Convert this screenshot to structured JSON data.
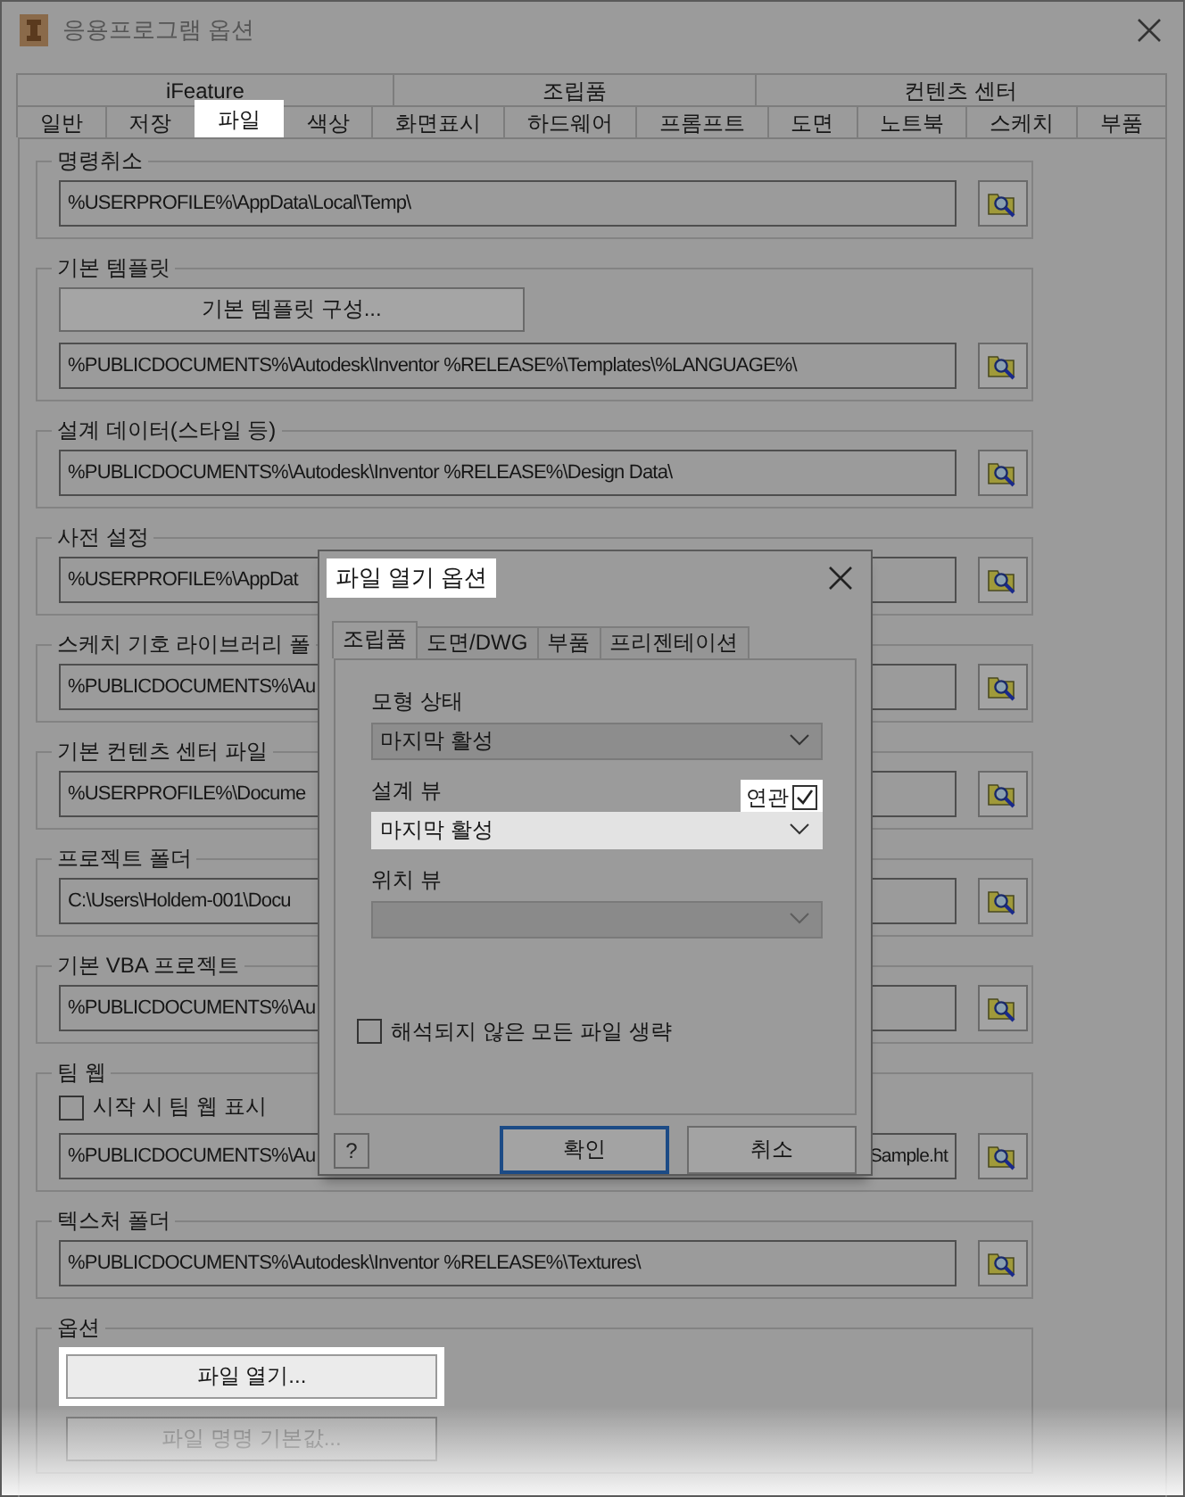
{
  "window": {
    "title": "응용프로그램 옵션"
  },
  "tab_rows": [
    [
      {
        "label": "iFeature",
        "selected": false
      },
      {
        "label": "조립품",
        "selected": false
      },
      {
        "label": "컨텐츠 센터",
        "selected": false
      }
    ],
    [
      {
        "label": "일반",
        "selected": false
      },
      {
        "label": "저장",
        "selected": false
      },
      {
        "label": "파일",
        "selected": true
      },
      {
        "label": "색상",
        "selected": false
      },
      {
        "label": "화면표시",
        "selected": false
      },
      {
        "label": "하드웨어",
        "selected": false
      },
      {
        "label": "프롬프트",
        "selected": false
      },
      {
        "label": "도면",
        "selected": false
      },
      {
        "label": "노트북",
        "selected": false
      },
      {
        "label": "스케치",
        "selected": false
      },
      {
        "label": "부품",
        "selected": false
      }
    ]
  ],
  "groups": [
    {
      "title": "명령취소",
      "items": [
        {
          "kind": "path",
          "value": "%USERPROFILE%\\AppData\\Local\\Temp\\"
        }
      ]
    },
    {
      "title": "기본 템플릿",
      "items": [
        {
          "kind": "button",
          "label": "기본 템플릿 구성...",
          "highlighted": false,
          "disabled": false
        },
        {
          "kind": "path",
          "value": "%PUBLICDOCUMENTS%\\Autodesk\\Inventor %RELEASE%\\Templates\\%LANGUAGE%\\"
        }
      ]
    },
    {
      "title": "설계 데이터(스타일 등)",
      "items": [
        {
          "kind": "path",
          "value": "%PUBLICDOCUMENTS%\\Autodesk\\Inventor %RELEASE%\\Design Data\\"
        }
      ]
    },
    {
      "title": "사전 설정",
      "items": [
        {
          "kind": "path",
          "value": "%USERPROFILE%\\AppDat"
        }
      ]
    },
    {
      "title": "스케치 기호 라이브러리 폴",
      "items": [
        {
          "kind": "path",
          "value": "%PUBLICDOCUMENTS%\\Au"
        }
      ]
    },
    {
      "title": "기본 컨텐츠 센터 파일",
      "items": [
        {
          "kind": "path",
          "value": "%USERPROFILE%\\Docume"
        }
      ]
    },
    {
      "title": "프로젝트 폴더",
      "items": [
        {
          "kind": "path",
          "value": "C:\\Users\\Holdem-001\\Docu"
        }
      ]
    },
    {
      "title": "기본 VBA 프로젝트",
      "items": [
        {
          "kind": "path",
          "value": "%PUBLICDOCUMENTS%\\Au"
        }
      ]
    },
    {
      "title": "팀 웹",
      "items": [
        {
          "kind": "checkbox",
          "label": "시작 시 팀 웹 표시",
          "checked": false
        },
        {
          "kind": "path",
          "value": "%PUBLICDOCUMENTS%\\Au",
          "value_end": "Sample.ht"
        }
      ]
    },
    {
      "title": "텍스처 폴더",
      "items": [
        {
          "kind": "path",
          "value": "%PUBLICDOCUMENTS%\\Autodesk\\Inventor %RELEASE%\\Textures\\"
        }
      ]
    },
    {
      "title": "옵션",
      "items": [
        {
          "kind": "button",
          "label": "파일 열기...",
          "highlighted": true,
          "disabled": false
        },
        {
          "kind": "button",
          "label": "파일 명명 기본값...",
          "highlighted": false,
          "disabled": true
        }
      ]
    }
  ],
  "dialog": {
    "title": "파일 열기 옵션",
    "title_highlighted": true,
    "tabs": [
      {
        "label": "조립품",
        "selected": true
      },
      {
        "label": "도면/DWG",
        "selected": false
      },
      {
        "label": "부품",
        "selected": false
      },
      {
        "label": "프리젠테이션",
        "selected": false
      }
    ],
    "dropdowns": [
      {
        "label": "모형 상태",
        "value": "마지막 활성",
        "highlighted": false,
        "disabled": false
      },
      {
        "label": "설계 뷰",
        "value": "마지막 활성",
        "highlighted": true,
        "disabled": false
      },
      {
        "label": "위치 뷰",
        "highlighted": false,
        "disabled": true
      }
    ],
    "associative": {
      "label": "연관",
      "checked": true,
      "highlighted": true
    },
    "skip_unresolved": {
      "label": "해석되지 않은 모든 파일 생략",
      "checked": false
    },
    "help": "?",
    "buttons": [
      {
        "label": "확인",
        "default": true
      },
      {
        "label": "취소",
        "default": false
      }
    ]
  }
}
